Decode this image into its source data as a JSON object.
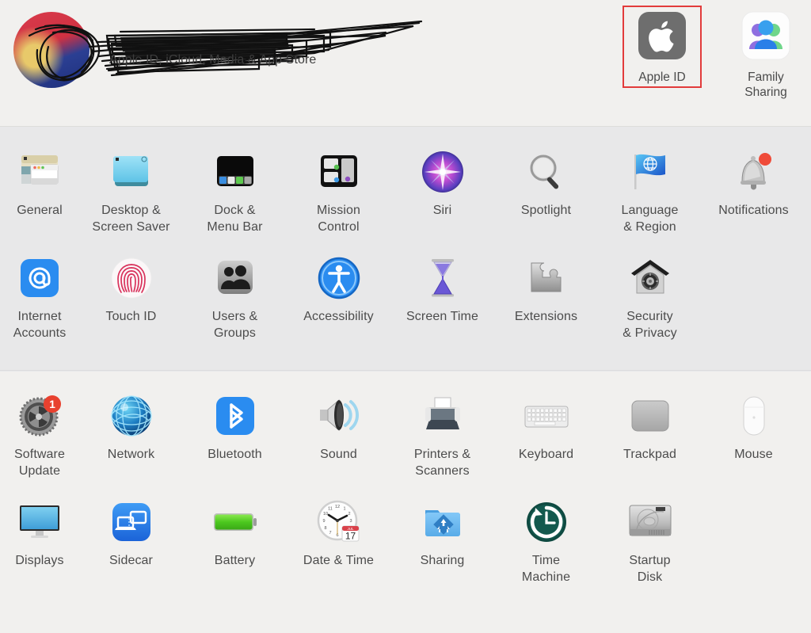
{
  "header": {
    "account_subtitle": "Apple ID, iCloud, Media & App Store",
    "name_redacted": true,
    "avatar_icon": "user-avatar-photo",
    "scribble_icon": "redaction-scribble",
    "tiles": [
      {
        "label": "Apple ID",
        "icon": "apple-logo-icon",
        "highlighted": true
      },
      {
        "label": "Family Sharing",
        "icon": "family-sharing-people-icon",
        "highlighted": false
      }
    ]
  },
  "highlight": {
    "color": "#e23b3b",
    "target": "Apple ID"
  },
  "colors": {
    "header_bg": "#f1f0ee",
    "section_a_bg": "#e8e8e9",
    "section_b_bg": "#f1f0ee",
    "label_text": "#4c4c4c",
    "badge_red": "#e8412f",
    "accent_blue": "#1f7ae0"
  },
  "sections": [
    {
      "name": "personal-settings",
      "rows": [
        [
          {
            "label": "General",
            "icon": "general-window-icon"
          },
          {
            "label": "Desktop &\nScreen Saver",
            "icon": "desktop-screensaver-icon"
          },
          {
            "label": "Dock &\nMenu Bar",
            "icon": "dock-menubar-icon"
          },
          {
            "label": "Mission\nControl",
            "icon": "mission-control-icon"
          },
          {
            "label": "Siri",
            "icon": "siri-orb-icon"
          },
          {
            "label": "Spotlight",
            "icon": "spotlight-magnifier-icon"
          },
          {
            "label": "Language\n& Region",
            "icon": "language-region-flag-icon"
          },
          {
            "label": "Notifications",
            "icon": "notifications-bell-icon"
          }
        ],
        [
          {
            "label": "Internet\nAccounts",
            "icon": "internet-accounts-at-icon"
          },
          {
            "label": "Touch ID",
            "icon": "touch-id-fingerprint-icon"
          },
          {
            "label": "Users &\nGroups",
            "icon": "users-groups-icon"
          },
          {
            "label": "Accessibility",
            "icon": "accessibility-person-icon"
          },
          {
            "label": "Screen Time",
            "icon": "screen-time-hourglass-icon"
          },
          {
            "label": "Extensions",
            "icon": "extensions-puzzle-icon"
          },
          {
            "label": "Security\n& Privacy",
            "icon": "security-privacy-house-icon"
          },
          {
            "label": "",
            "icon": ""
          }
        ]
      ]
    },
    {
      "name": "hardware-settings",
      "rows": [
        [
          {
            "label": "Software\nUpdate",
            "icon": "software-update-gear-icon",
            "badge": "1"
          },
          {
            "label": "Network",
            "icon": "network-globe-icon"
          },
          {
            "label": "Bluetooth",
            "icon": "bluetooth-icon"
          },
          {
            "label": "Sound",
            "icon": "sound-speaker-icon"
          },
          {
            "label": "Printers &\nScanners",
            "icon": "printer-icon"
          },
          {
            "label": "Keyboard",
            "icon": "keyboard-icon"
          },
          {
            "label": "Trackpad",
            "icon": "trackpad-icon"
          },
          {
            "label": "Mouse",
            "icon": "mouse-icon"
          }
        ],
        [
          {
            "label": "Displays",
            "icon": "display-monitor-icon"
          },
          {
            "label": "Sidecar",
            "icon": "sidecar-ipad-icon"
          },
          {
            "label": "Battery",
            "icon": "battery-icon"
          },
          {
            "label": "Date & Time",
            "icon": "clock-calendar-icon",
            "clock_date": "17",
            "clock_month": "JUL"
          },
          {
            "label": "Sharing",
            "icon": "sharing-folder-icon"
          },
          {
            "label": "Time\nMachine",
            "icon": "time-machine-icon"
          },
          {
            "label": "Startup\nDisk",
            "icon": "startup-disk-icon"
          },
          {
            "label": "",
            "icon": ""
          }
        ]
      ]
    }
  ]
}
